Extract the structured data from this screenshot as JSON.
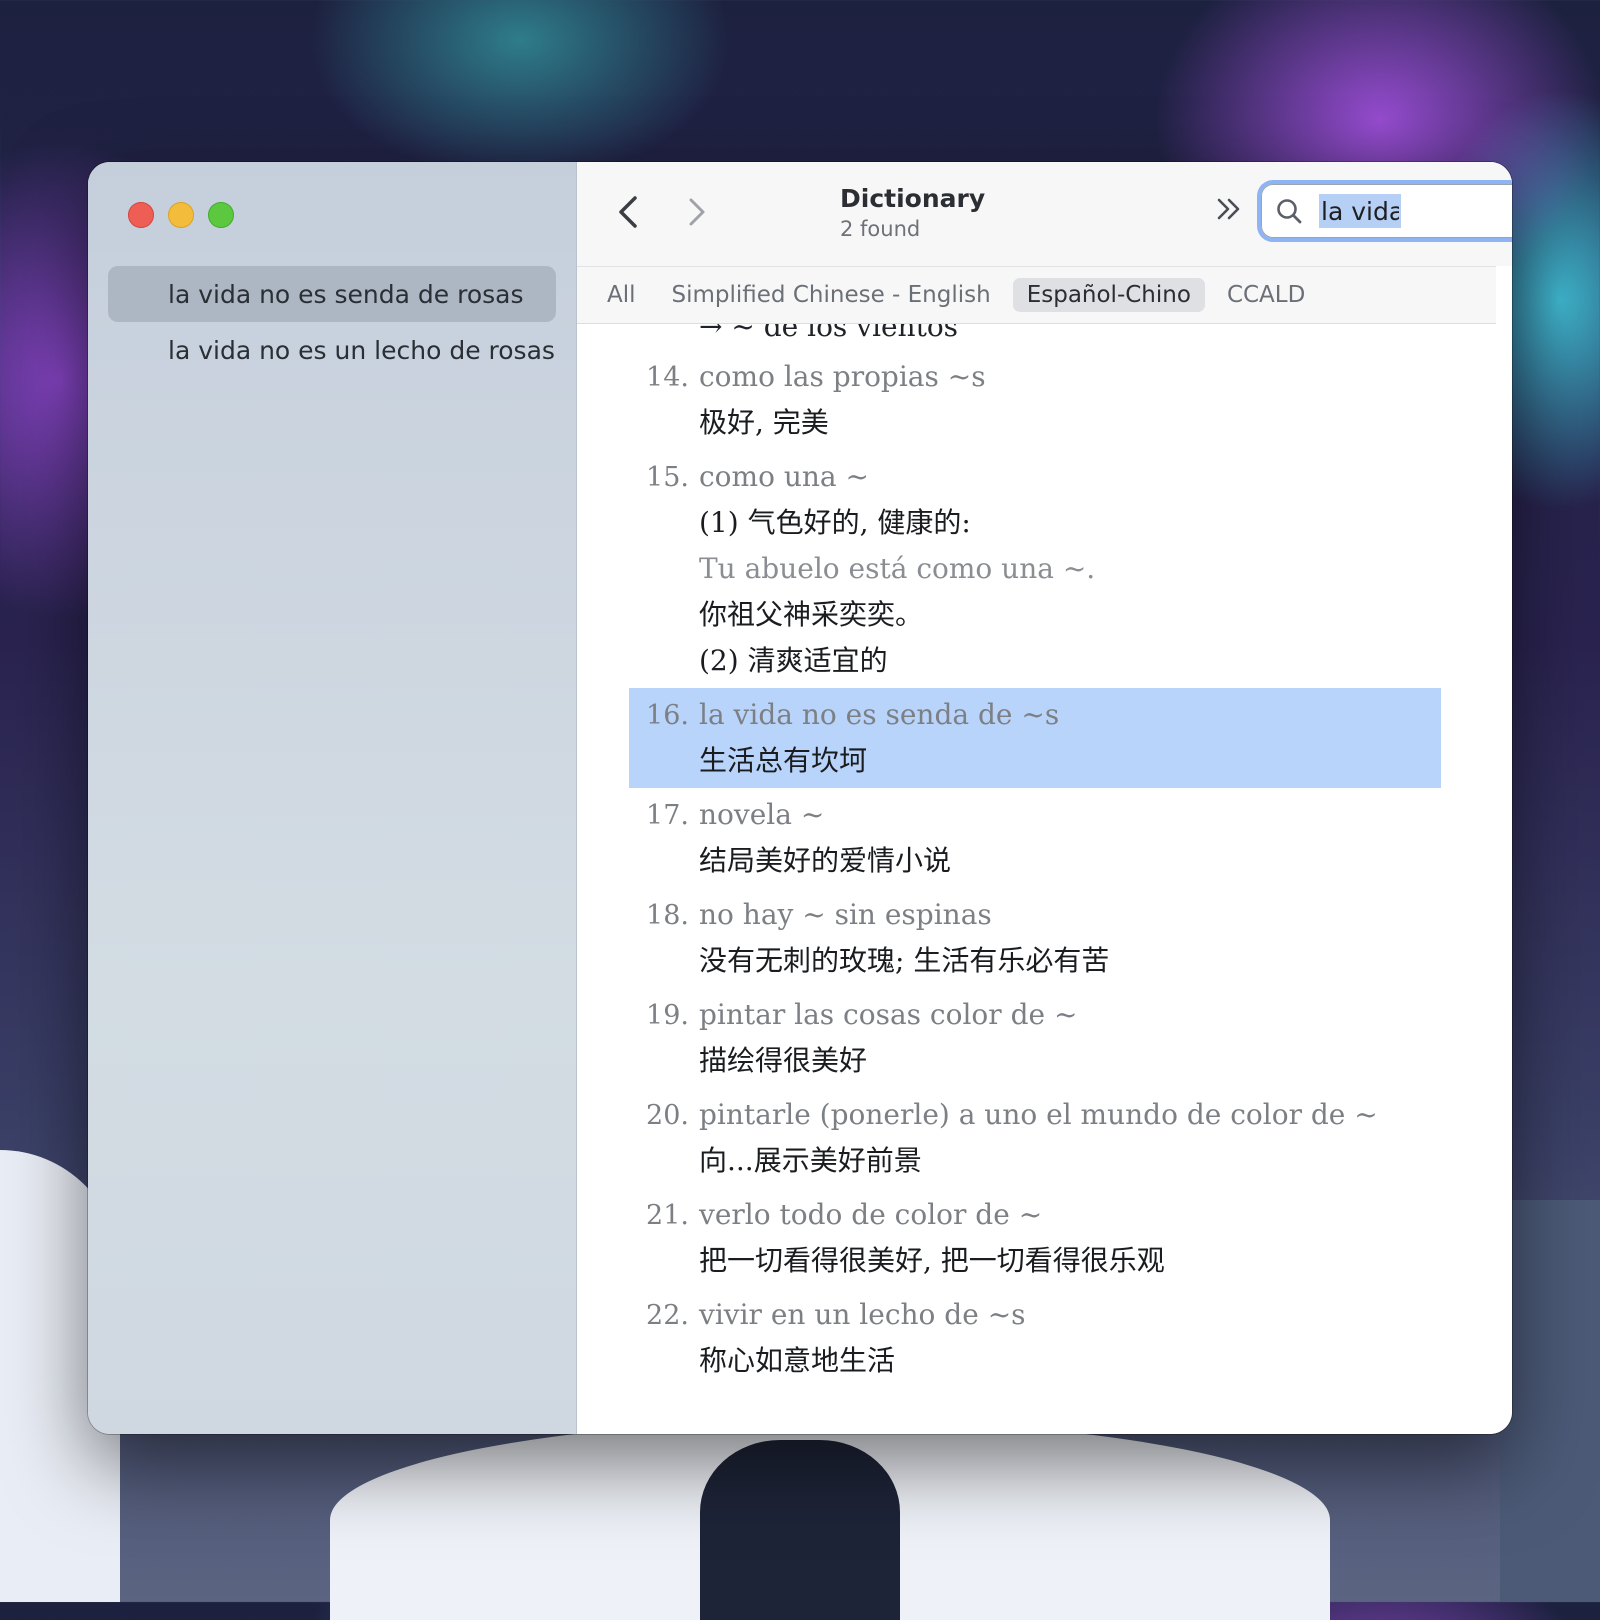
{
  "sidebar": {
    "results": [
      {
        "label": "la vida no es senda de rosas"
      },
      {
        "label": "la vida no es un lecho de rosas"
      }
    ]
  },
  "toolbar": {
    "back_icon": "chevron-left-icon",
    "forward_icon": "chevron-right-icon",
    "title": "Dictionary",
    "subtitle": "2 found",
    "more_icon": "double-chevron-right-icon",
    "search_value": "la vida",
    "search_icon": "search-icon",
    "clear_icon": "clear-circle-icon"
  },
  "filters": [
    {
      "label": "All"
    },
    {
      "label": "Simplified Chinese - English"
    },
    {
      "label": "Español-Chino"
    },
    {
      "label": "CCALD"
    }
  ],
  "content": {
    "cut_line": "→ ~ de los vientos",
    "entries": [
      {
        "num": "14.",
        "es": "como las propias ~s",
        "lines": [
          "极好, 完美"
        ]
      },
      {
        "num": "15.",
        "es": "como una ~",
        "lines": [
          "(1) 气色好的, 健康的:",
          "Tu abuelo está como una ~.",
          "你祖父神采奕奕。",
          "(2) 清爽适宜的"
        ]
      },
      {
        "num": "16.",
        "es": "la vida no es senda de ~s",
        "lines": [
          "生活总有坎坷"
        ]
      },
      {
        "num": "17.",
        "es": "novela ~",
        "lines": [
          "结局美好的爱情小说"
        ]
      },
      {
        "num": "18.",
        "es": "no hay ~ sin espinas",
        "lines": [
          "没有无刺的玫瑰; 生活有乐必有苦"
        ]
      },
      {
        "num": "19.",
        "es": "pintar las cosas color de ~",
        "lines": [
          "描绘得很美好"
        ]
      },
      {
        "num": "20.",
        "es": "pintarle (ponerle) a uno el mundo de color de ~",
        "lines": [
          "向...展示美好前景"
        ]
      },
      {
        "num": "21.",
        "es": "verlo todo de color de ~",
        "lines": [
          "把一切看得很美好, 把一切看得很乐观"
        ]
      },
      {
        "num": "22.",
        "es": "vivir en un lecho de ~s",
        "lines": [
          "称心如意地生活"
        ]
      }
    ]
  }
}
